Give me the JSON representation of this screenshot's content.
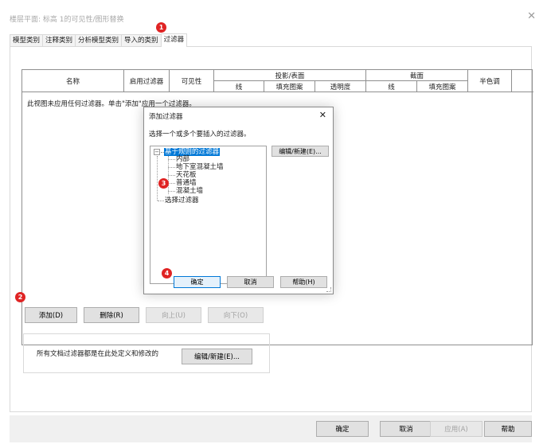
{
  "window": {
    "title": "楼层平面: 标高 1的可见性/图形替换",
    "close_glyph": "✕"
  },
  "tabs": [
    {
      "label": "模型类别"
    },
    {
      "label": "注释类别"
    },
    {
      "label": "分析模型类别"
    },
    {
      "label": "导入的类别"
    },
    {
      "label": "过滤器",
      "active": true
    }
  ],
  "table": {
    "col_name": "名称",
    "col_enable": "启用过滤器",
    "col_visibility": "可见性",
    "group_projection": "投影/表面",
    "group_cut": "截面",
    "col_halftone": "半色调",
    "sub_line": "线",
    "sub_fill": "填充图案",
    "sub_transparency": "透明度",
    "cut_line": "线",
    "cut_fill": "填充图案",
    "empty_message": "此视图未应用任何过滤器。单击\"添加\"应用一个过滤器。"
  },
  "buttons": {
    "add": "添加(D)",
    "delete": "删除(R)",
    "up": "向上(U)",
    "down": "向下(O)"
  },
  "doc_filters": {
    "text": "所有文档过滤器都是在此处定义和修改的",
    "edit_button": "编辑/新建(E)..."
  },
  "footer": {
    "ok": "确定",
    "cancel": "取消",
    "apply": "应用(A)",
    "help": "帮助"
  },
  "modal": {
    "title": "添加过滤器",
    "close_glyph": "✕",
    "prompt": "选择一个或多个要插入的过滤器。",
    "tree": {
      "expander": "−",
      "group_rule": "基于规则的过滤器",
      "rule_items": [
        "内部",
        "地下室混凝土墙",
        "天花板",
        "普通墙",
        "混凝土墙"
      ],
      "group_selection": "选择过滤器"
    },
    "edit_button": "编辑/新建(E)...",
    "ok": "确定",
    "cancel": "取消",
    "help": "帮助(H)"
  },
  "annotations": [
    "1",
    "2",
    "3",
    "4"
  ],
  "colors": {
    "badge": "#e02424",
    "selection": "#0078d7"
  }
}
